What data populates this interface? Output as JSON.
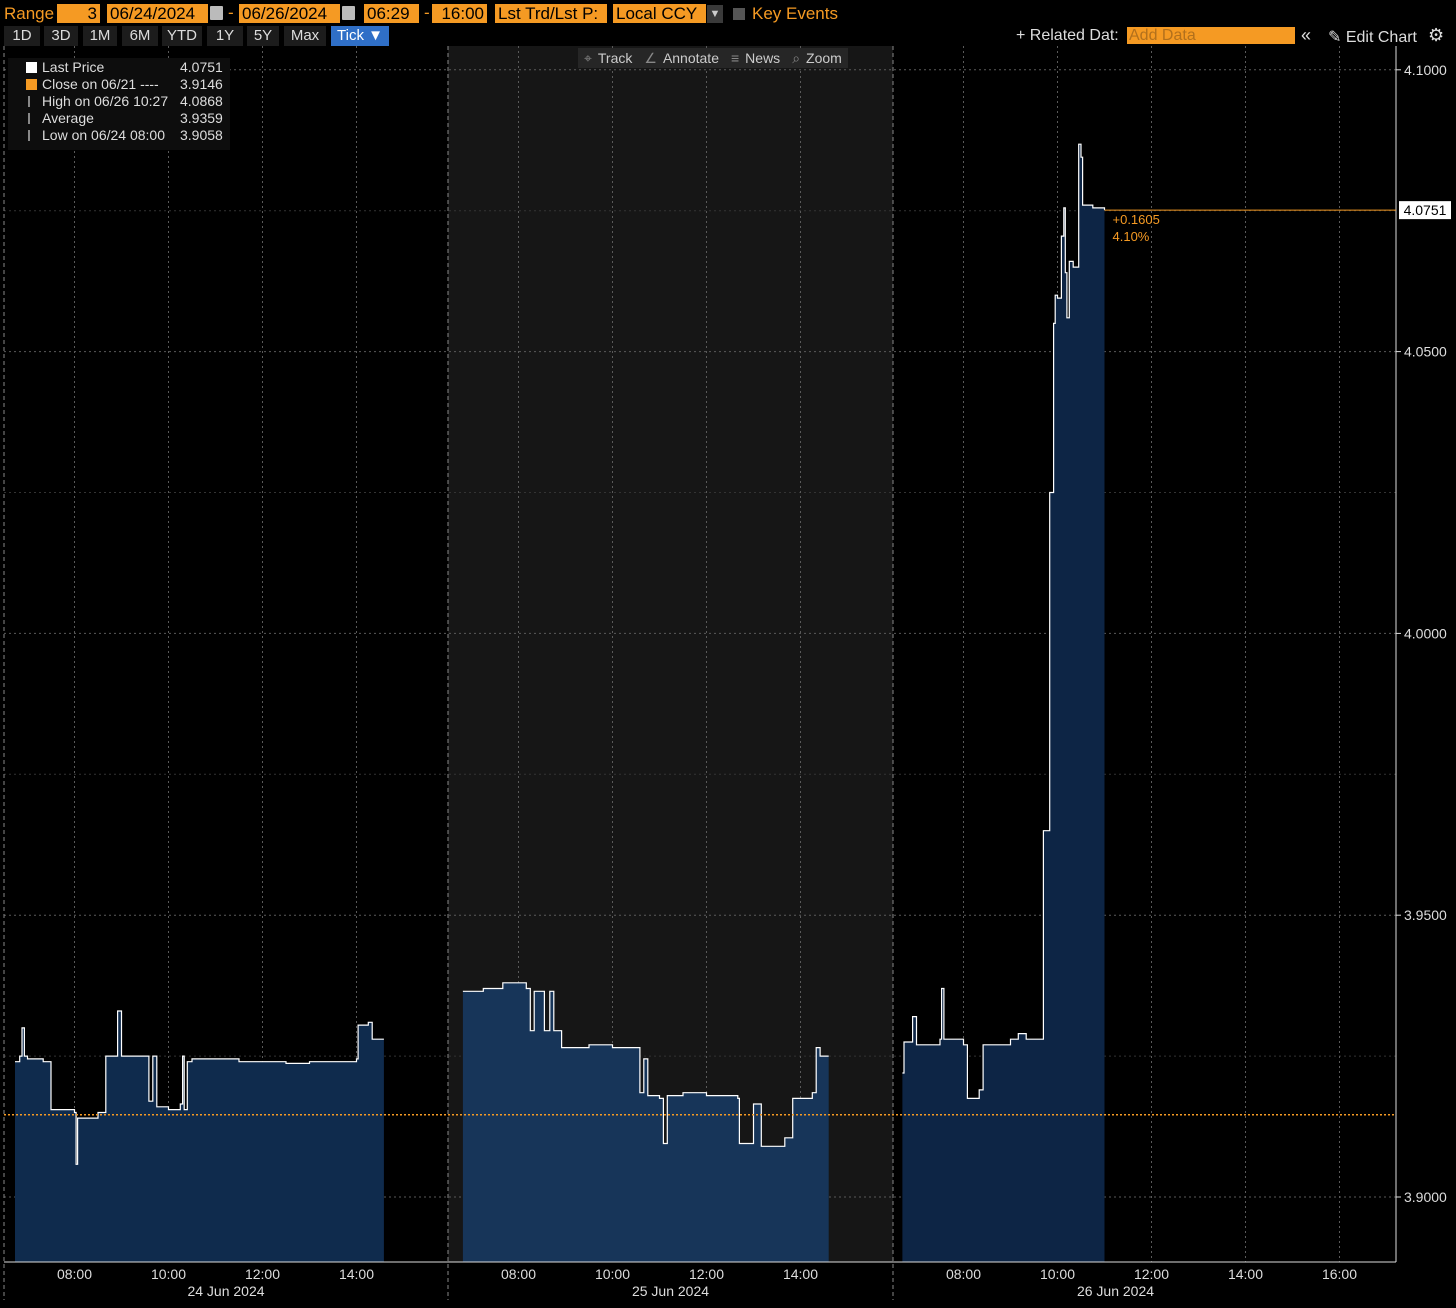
{
  "toolbar": {
    "range_label": "Range",
    "range_value": "3",
    "start_date": "06/24/2024",
    "end_date": "06/26/2024",
    "start_time": "06:29",
    "end_time": "16:00",
    "price_type": "Lst Trd/Lst P:",
    "currency": "Local CCY",
    "key_events": "Key Events",
    "dash": "-"
  },
  "periods": [
    "1D",
    "3D",
    "1M",
    "6M",
    "YTD",
    "1Y",
    "5Y",
    "Max",
    "Tick ▼"
  ],
  "active_period": "Tick",
  "right_toolbar": {
    "related_data": "+ Related Dat:",
    "add_data_placeholder": "Add Data",
    "collapse_icon": "«",
    "edit_chart": "Edit Chart",
    "gear_icon": "⚙"
  },
  "tools": [
    {
      "icon": "⌖",
      "label": "Track"
    },
    {
      "icon": "∠",
      "label": "Annotate"
    },
    {
      "icon": "≡",
      "label": "News"
    },
    {
      "icon": "⌕",
      "label": "Zoom"
    }
  ],
  "legend": [
    {
      "name": "Last Price",
      "value": "4.0751",
      "color": "#ffffff"
    },
    {
      "name": "Close on 06/21 ----",
      "value": "3.9146",
      "color": "#f59a23"
    },
    {
      "name": "High on 06/26 10:27",
      "value": "4.0868",
      "color": "#888888"
    },
    {
      "name": "Average",
      "value": "3.9359",
      "color": "#888888"
    },
    {
      "name": "Low on 06/24 08:00",
      "value": "3.9058",
      "color": "#888888"
    }
  ],
  "colors": {
    "accent": "#f59a23",
    "area_day1": "#0f2b4d",
    "area_day2": "#173559",
    "area_day3": "#0d2545",
    "line": "#ffffff",
    "shade": "#161616",
    "grid": "#5a5a5a"
  },
  "chart_data": {
    "type": "area",
    "y_ticks": [
      "4.1000",
      "4.0500",
      "4.0000",
      "3.9500",
      "3.9000"
    ],
    "ylim": [
      3.888,
      4.1
    ],
    "reference_line": {
      "label": "Close on 06/21",
      "value": 3.9146
    },
    "last_price_label": "4.0751",
    "change": {
      "abs": "+0.1605",
      "pct": "4.10%"
    },
    "days": [
      {
        "label": "24 Jun 2024",
        "xlim": [
          "06:30",
          "16:00"
        ],
        "ticks": [
          "08:00",
          "10:00",
          "12:00",
          "14:00"
        ],
        "series": [
          [
            "06:44",
            3.924
          ],
          [
            "06:50",
            3.925
          ],
          [
            "06:53",
            3.93
          ],
          [
            "06:56",
            3.925
          ],
          [
            "07:00",
            3.9245
          ],
          [
            "07:20",
            3.924
          ],
          [
            "07:30",
            3.9155
          ],
          [
            "08:00",
            3.915
          ],
          [
            "08:02",
            3.9058
          ],
          [
            "08:04",
            3.914
          ],
          [
            "08:30",
            3.915
          ],
          [
            "08:40",
            3.925
          ],
          [
            "08:55",
            3.933
          ],
          [
            "09:00",
            3.925
          ],
          [
            "09:30",
            3.925
          ],
          [
            "09:35",
            3.917
          ],
          [
            "09:40",
            3.925
          ],
          [
            "09:45",
            3.916
          ],
          [
            "10:00",
            3.9155
          ],
          [
            "10:15",
            3.9165
          ],
          [
            "10:18",
            3.925
          ],
          [
            "10:20",
            3.9155
          ],
          [
            "10:24",
            3.924
          ],
          [
            "10:30",
            3.9245
          ],
          [
            "11:30",
            3.924
          ],
          [
            "12:30",
            3.9237
          ],
          [
            "13:00",
            3.924
          ],
          [
            "14:00",
            3.9245
          ],
          [
            "14:02",
            3.9305
          ],
          [
            "14:15",
            3.931
          ],
          [
            "14:20",
            3.928
          ],
          [
            "14:35",
            3.928
          ]
        ]
      },
      {
        "label": "25 Jun 2024",
        "xlim": [
          "06:30",
          "16:00"
        ],
        "ticks": [
          "08:00",
          "10:00",
          "12:00",
          "14:00"
        ],
        "series": [
          [
            "06:49",
            3.9365
          ],
          [
            "07:15",
            3.937
          ],
          [
            "07:40",
            3.938
          ],
          [
            "08:00",
            3.938
          ],
          [
            "08:10",
            3.937
          ],
          [
            "08:15",
            3.9295
          ],
          [
            "08:20",
            3.9365
          ],
          [
            "08:30",
            3.9365
          ],
          [
            "08:33",
            3.9295
          ],
          [
            "08:40",
            3.9365
          ],
          [
            "08:45",
            3.9295
          ],
          [
            "08:55",
            3.9265
          ],
          [
            "09:30",
            3.927
          ],
          [
            "10:00",
            3.9265
          ],
          [
            "10:30",
            3.9265
          ],
          [
            "10:35",
            3.9185
          ],
          [
            "10:40",
            3.9245
          ],
          [
            "10:45",
            3.918
          ],
          [
            "11:00",
            3.9175
          ],
          [
            "11:05",
            3.9095
          ],
          [
            "11:10",
            3.918
          ],
          [
            "11:30",
            3.9185
          ],
          [
            "12:00",
            3.918
          ],
          [
            "12:40",
            3.9175
          ],
          [
            "12:42",
            3.9095
          ],
          [
            "12:55",
            3.9095
          ],
          [
            "13:00",
            3.9165
          ],
          [
            "13:10",
            3.909
          ],
          [
            "13:40",
            3.9105
          ],
          [
            "13:50",
            3.9175
          ],
          [
            "14:15",
            3.9185
          ],
          [
            "14:20",
            3.9265
          ],
          [
            "14:25",
            3.925
          ],
          [
            "14:36",
            3.925
          ]
        ]
      },
      {
        "label": "26 Jun 2024",
        "xlim": [
          "06:30",
          "16:00"
        ],
        "ticks": [
          "08:00",
          "10:00",
          "12:00",
          "14:00",
          "16:00"
        ],
        "series": [
          [
            "06:42",
            3.922
          ],
          [
            "06:44",
            3.9275
          ],
          [
            "06:55",
            3.932
          ],
          [
            "07:00",
            3.927
          ],
          [
            "07:20",
            3.927
          ],
          [
            "07:30",
            3.928
          ],
          [
            "07:32",
            3.937
          ],
          [
            "07:35",
            3.928
          ],
          [
            "08:00",
            3.927
          ],
          [
            "08:05",
            3.9175
          ],
          [
            "08:20",
            3.919
          ],
          [
            "08:25",
            3.927
          ],
          [
            "09:00",
            3.928
          ],
          [
            "09:10",
            3.929
          ],
          [
            "09:20",
            3.928
          ],
          [
            "09:30",
            3.928
          ],
          [
            "09:42",
            3.965
          ],
          [
            "09:50",
            4.025
          ],
          [
            "09:55",
            4.055
          ],
          [
            "09:57",
            4.06
          ],
          [
            "10:00",
            4.0595
          ],
          [
            "10:05",
            4.0705
          ],
          [
            "10:08",
            4.0755
          ],
          [
            "10:10",
            4.064
          ],
          [
            "10:12",
            4.056
          ],
          [
            "10:15",
            4.066
          ],
          [
            "10:20",
            4.065
          ],
          [
            "10:27",
            4.0868
          ],
          [
            "10:30",
            4.0845
          ],
          [
            "10:32",
            4.076
          ],
          [
            "10:45",
            4.0755
          ],
          [
            "11:00",
            4.0751
          ]
        ]
      }
    ]
  }
}
